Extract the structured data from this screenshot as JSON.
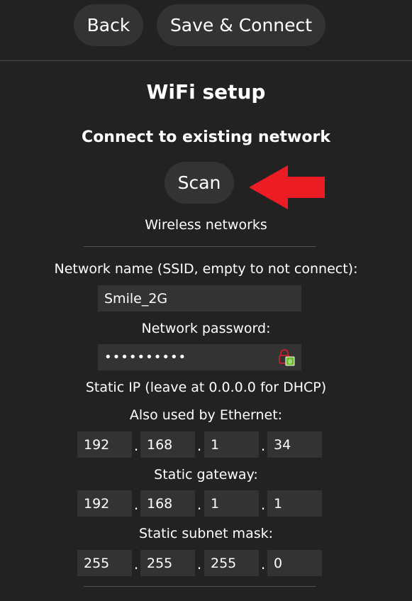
{
  "header": {
    "back_label": "Back",
    "save_label": "Save & Connect"
  },
  "page": {
    "title": "WiFi setup",
    "subtitle": "Connect to existing network",
    "scan_label": "Scan",
    "networks_label": "Wireless networks"
  },
  "form": {
    "ssid_label": "Network name (SSID, empty to not connect):",
    "ssid_value": "Smile_2G",
    "password_label": "Network password:",
    "password_value": "••••••••••",
    "static_ip_label": "Static IP (leave at 0.0.0.0 for DHCP)",
    "ethernet_label": "Also used by Ethernet:",
    "static_ip": [
      "192",
      "168",
      "1",
      "34"
    ],
    "gateway_label": "Static gateway:",
    "gateway": [
      "192",
      "168",
      "1",
      "1"
    ],
    "subnet_label": "Static subnet mask:",
    "subnet": [
      "255",
      "255",
      "255",
      "0"
    ],
    "separator": "."
  },
  "icons": {
    "password_manager": "lock-icon",
    "annotation": "arrow-icon"
  },
  "colors": {
    "background": "#222222",
    "control": "#333333",
    "annotation_arrow": "#ec1c24"
  }
}
